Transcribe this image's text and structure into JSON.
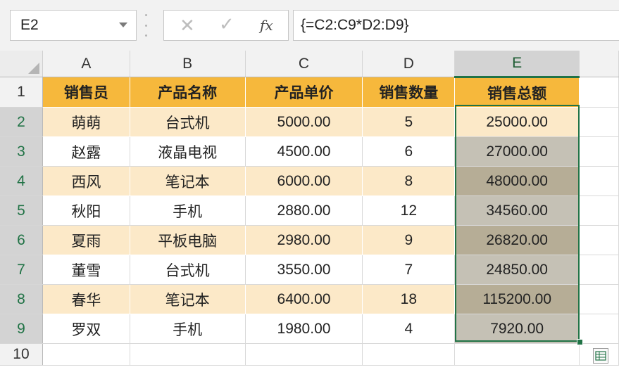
{
  "namebox": {
    "value": "E2"
  },
  "formula_bar": {
    "cancel_glyph": "✕",
    "enter_glyph": "✓",
    "fx_label": "fx",
    "formula": "{=C2:C9*D2:D9}"
  },
  "columns": [
    "A",
    "B",
    "C",
    "D",
    "E"
  ],
  "active_column": "E",
  "rows": [
    "1",
    "2",
    "3",
    "4",
    "5",
    "6",
    "7",
    "8",
    "9",
    "10"
  ],
  "headers": [
    "销售员",
    "产品名称",
    "产品单价",
    "销售数量",
    "销售总额"
  ],
  "data": [
    [
      "萌萌",
      "台式机",
      "5000.00",
      "5",
      "25000.00"
    ],
    [
      "赵露",
      "液晶电视",
      "4500.00",
      "6",
      "27000.00"
    ],
    [
      "西风",
      "笔记本",
      "6000.00",
      "8",
      "48000.00"
    ],
    [
      "秋阳",
      "手机",
      "2880.00",
      "12",
      "34560.00"
    ],
    [
      "夏雨",
      "平板电脑",
      "2980.00",
      "9",
      "26820.00"
    ],
    [
      "董雪",
      "台式机",
      "3550.00",
      "7",
      "24850.00"
    ],
    [
      "春华",
      "笔记本",
      "6400.00",
      "18",
      "115200.00"
    ],
    [
      "罗双",
      "手机",
      "1980.00",
      "4",
      "7920.00"
    ]
  ],
  "colors": {
    "header_fill": "#f6b83c",
    "band_fill": "#fce9c8",
    "selection_border": "#217346"
  },
  "icons": {
    "namebox_dropdown": "chevron-down-icon",
    "quick_analysis": "quick-analysis-icon"
  }
}
